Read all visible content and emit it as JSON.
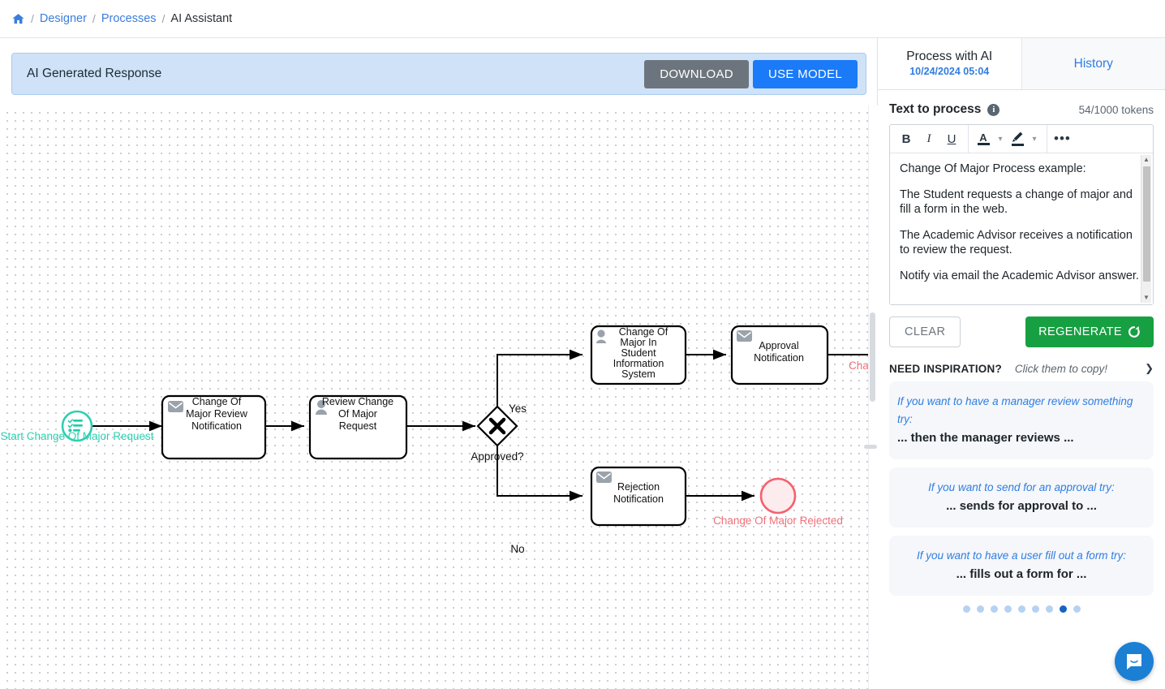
{
  "breadcrumb": {
    "home_icon": "home-icon",
    "items": [
      {
        "label": "Designer",
        "link": true
      },
      {
        "label": "Processes",
        "link": true
      },
      {
        "label": "AI Assistant",
        "link": false
      }
    ],
    "separator": "/"
  },
  "banner": {
    "title": "AI Generated Response",
    "download_label": "DOWNLOAD",
    "use_model_label": "USE MODEL",
    "bg_color": "#cfe2f7",
    "download_color": "#6c757d",
    "use_model_color": "#1a7af8"
  },
  "diagram": {
    "type": "bpmn",
    "start_event": {
      "name": "start-event",
      "label": "Start Change Of Major Request",
      "icon": "form-checklist-icon",
      "color": "#2ecfb0"
    },
    "tasks": [
      {
        "name": "task-change-of-major-review-notification",
        "label": "Change Of Major Review Notification",
        "icon": "envelope-icon"
      },
      {
        "name": "task-review-change-of-major-request",
        "label": "Review Change Of Major Request",
        "icon": "user-icon"
      },
      {
        "name": "task-change-of-major-in-sis",
        "label": "Change Of Major In Student Information System",
        "icon": "user-icon"
      },
      {
        "name": "task-approval-notification",
        "label": "Approval Notification",
        "icon": "envelope-icon"
      },
      {
        "name": "task-rejection-notification",
        "label": "Rejection Notification",
        "icon": "envelope-icon"
      }
    ],
    "gateway": {
      "name": "exclusive-gateway",
      "label": "Approved?",
      "type": "exclusive"
    },
    "flow_labels": {
      "yes": "Yes",
      "no": "No"
    },
    "end_events": [
      {
        "name": "end-event-approved",
        "label": "Cha",
        "color": "#f2707a",
        "clipped": true
      },
      {
        "name": "end-event-rejected",
        "label": "Change Of Major Rejected",
        "color": "#f2707a",
        "clipped": false
      }
    ]
  },
  "panel": {
    "tabs": [
      {
        "label": "Process with AI",
        "sublabel": "10/24/2024 05:04",
        "active": true
      },
      {
        "label": "History",
        "sublabel": "",
        "active": false
      }
    ],
    "text_to_process_label": "Text to process",
    "info_icon": "info-icon",
    "tokens": "54/1000 tokens",
    "toolbar": {
      "bold": "B",
      "italic": "I",
      "underline": "U",
      "font_color": "A",
      "font_color_caret": "chevron-down-icon",
      "highlight": "pen-icon",
      "highlight_caret": "chevron-down-icon",
      "more": "•••"
    },
    "editor_paragraphs": [
      "Change Of Major Process example:",
      "The Student requests a change of major and fill a form in the web.",
      "The Academic Advisor receives a notification to review the request.",
      "Notify via email the Academic Advisor answer."
    ],
    "scroll_up": "▲",
    "scroll_down": "▼",
    "clear_label": "CLEAR",
    "regenerate_label": "REGENERATE",
    "regenerate_icon": "refresh-icon",
    "regenerate_color": "#17a042",
    "inspiration": {
      "title": "NEED INSPIRATION?",
      "hint": "Click them to copy!",
      "chevron": "chevron-down-icon",
      "cards": [
        {
          "question": "If you want to have a manager review something try:",
          "answer": "... then the manager reviews ...",
          "align": "left"
        },
        {
          "question": "If you want to send for an approval try:",
          "answer": "... sends for approval to ...",
          "align": "center"
        },
        {
          "question": "If you want to have a user fill out a form try:",
          "answer": "... fills out a form for ...",
          "align": "center"
        }
      ],
      "dot_count": 9,
      "active_dot": 8
    }
  },
  "chat_launcher": {
    "name": "chat-launcher",
    "icon": "chat-bubble-icon",
    "color": "#1b7fd4"
  }
}
